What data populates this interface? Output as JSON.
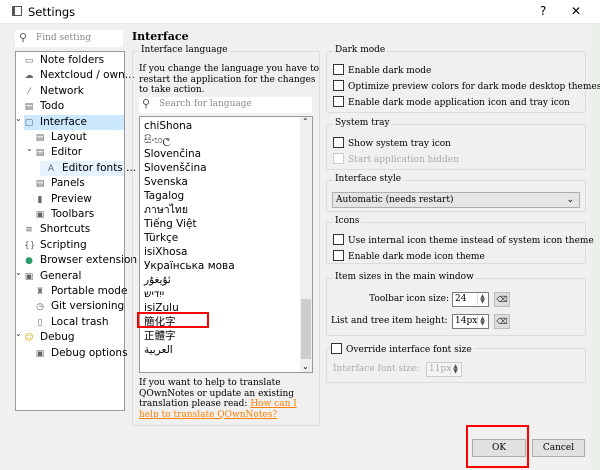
{
  "window": {
    "title": "Settings",
    "help": "?",
    "close": "✕"
  },
  "sidebar": {
    "search_placeholder": "Find setting",
    "items": [
      {
        "label": "Note folders",
        "icon": "folder-icon",
        "glyph": "▭",
        "indent": 0
      },
      {
        "label": "Nextcloud / own...",
        "icon": "cloud-icon",
        "glyph": "☁",
        "indent": 0
      },
      {
        "label": "Network",
        "icon": "network-icon",
        "glyph": "⁄",
        "indent": 0
      },
      {
        "label": "Todo",
        "icon": "todo-icon",
        "glyph": "▤",
        "indent": 0
      },
      {
        "label": "Interface",
        "icon": "interface-icon",
        "glyph": "▢",
        "indent": 0,
        "expanded": true,
        "selected": true
      },
      {
        "label": "Layout",
        "icon": "layout-icon",
        "glyph": "▤",
        "indent": 1
      },
      {
        "label": "Editor",
        "icon": "editor-icon",
        "glyph": "▤",
        "indent": 1,
        "expanded": true
      },
      {
        "label": "Editor fonts ...",
        "icon": "font-icon",
        "glyph": "A",
        "indent": 2,
        "highlight": true
      },
      {
        "label": "Panels",
        "icon": "panels-icon",
        "glyph": "▤",
        "indent": 1
      },
      {
        "label": "Preview",
        "icon": "preview-icon",
        "glyph": "▮",
        "indent": 1
      },
      {
        "label": "Toolbars",
        "icon": "toolbars-icon",
        "glyph": "▣",
        "indent": 1
      },
      {
        "label": "Shortcuts",
        "icon": "shortcuts-icon",
        "glyph": "≡",
        "indent": 0
      },
      {
        "label": "Scripting",
        "icon": "scripting-icon",
        "glyph": "{}",
        "indent": 0
      },
      {
        "label": "Browser extension",
        "icon": "globe-icon",
        "glyph": "●",
        "indent": 0
      },
      {
        "label": "General",
        "icon": "general-icon",
        "glyph": "▣",
        "indent": 0,
        "expanded": true
      },
      {
        "label": "Portable mode",
        "icon": "portable-icon",
        "glyph": "♜",
        "indent": 1
      },
      {
        "label": "Git versioning",
        "icon": "clock-icon",
        "glyph": "◷",
        "indent": 1
      },
      {
        "label": "Local trash",
        "icon": "trash-icon",
        "glyph": "▯",
        "indent": 1
      },
      {
        "label": "Debug",
        "icon": "smiley-icon",
        "glyph": "☺",
        "indent": 0,
        "expanded": true
      },
      {
        "label": "Debug options",
        "icon": "debug-options-icon",
        "glyph": "▣",
        "indent": 1
      }
    ]
  },
  "main": {
    "heading": "Interface",
    "language": {
      "group_label": "Interface language",
      "description": "If you change the language you have to restart the application for the changes to take action.",
      "search_placeholder": "Search for language",
      "items": [
        "chiShona",
        "සිංහල",
        "Slovenčina",
        "Slovenščina",
        "Svenska",
        "Tagalog",
        "ภาษาไทย",
        "Tiếng Việt",
        "Türkçe",
        "isiXhosa",
        "Українська мова",
        "ئۇيغۇر",
        "ייִדיש",
        "isiZulu",
        "簡化字",
        "正體字",
        "العربية"
      ],
      "highlighted": "簡化字",
      "scroll_fraction": 0.92,
      "help_text": "If you want to help to translate QOwnNotes or update an existing translation please read:",
      "help_link": "How can I help to translate QOwnNotes?"
    },
    "dark_mode": {
      "label": "Dark mode",
      "options": [
        "Enable dark mode",
        "Optimize preview colors for dark mode desktop themes",
        "Enable dark mode application icon and tray icon"
      ]
    },
    "system_tray": {
      "label": "System tray",
      "show": "Show system tray icon",
      "hidden": "Start application hidden"
    },
    "style": {
      "label": "Interface style",
      "value": "Automatic (needs restart)"
    },
    "icons": {
      "label": "Icons",
      "options": [
        "Use internal icon theme instead of system icon theme",
        "Enable dark mode icon theme"
      ]
    },
    "sizes": {
      "label": "Item sizes in the main window",
      "toolbar_label": "Toolbar icon size:",
      "toolbar_value": "24",
      "tree_label": "List and tree item height:",
      "tree_value": "14px"
    },
    "font": {
      "label": "Override interface font size",
      "size_label": "Interface font size:",
      "size_value": "11px"
    }
  },
  "buttons": {
    "ok": "OK",
    "cancel": "Cancel"
  },
  "colors": {
    "highlight": "#ff0000",
    "link": "#ff7e00",
    "selection": "#cce8ff"
  }
}
